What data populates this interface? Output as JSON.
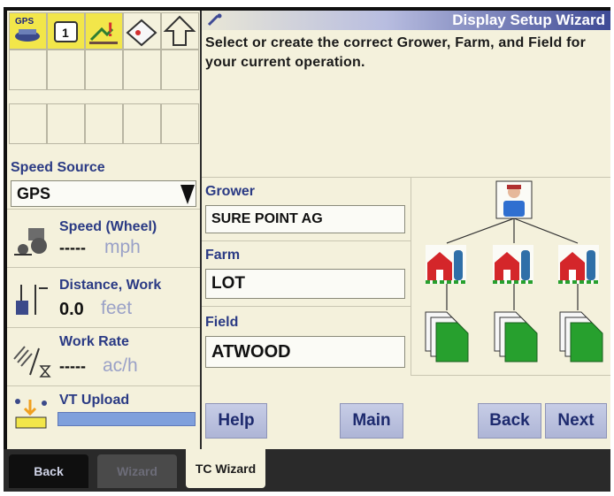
{
  "window": {
    "title": "Display Setup Wizard"
  },
  "top_icons": [
    {
      "name": "gps-receiver-icon",
      "label": "GPS"
    },
    {
      "name": "page-one-icon",
      "label": "1"
    },
    {
      "name": "alarm-icon",
      "label": "!"
    },
    {
      "name": "compass-tag-icon",
      "label": ""
    },
    {
      "name": "up-arrow-icon",
      "label": ""
    }
  ],
  "left_panel": {
    "speed_source_label": "Speed Source",
    "speed_source_value": "GPS",
    "speed_title": "Speed (Wheel)",
    "speed_value": "-----",
    "speed_unit": "mph",
    "distance_title": "Distance, Work",
    "distance_value": "0.0",
    "distance_unit": "feet",
    "workrate_title": "Work Rate",
    "workrate_value": "-----",
    "workrate_unit": "ac/h",
    "vt_upload_label": "VT Upload",
    "vt_upload_progress": 1.0
  },
  "instruction": "Select or create the correct Grower, Farm, and Field for your current operation.",
  "form": {
    "grower_label": "Grower",
    "grower_value": "SURE POINT AG",
    "farm_label": "Farm",
    "farm_value": "LOT",
    "field_label": "Field",
    "field_value": "ATWOOD"
  },
  "buttons": {
    "help": "Help",
    "main": "Main",
    "back": "Back",
    "next": "Next"
  },
  "tabs": {
    "back": "Back",
    "wizard": "Wizard",
    "tc_wizard": "TC Wizard"
  },
  "colors": {
    "title_blue": "#3e4a95",
    "label_blue": "#2a3a84",
    "panel_cream": "#f4f1dc",
    "barn_red": "#d4262a",
    "field_green": "#27a02e",
    "progress_blue": "#7fa0dc"
  }
}
